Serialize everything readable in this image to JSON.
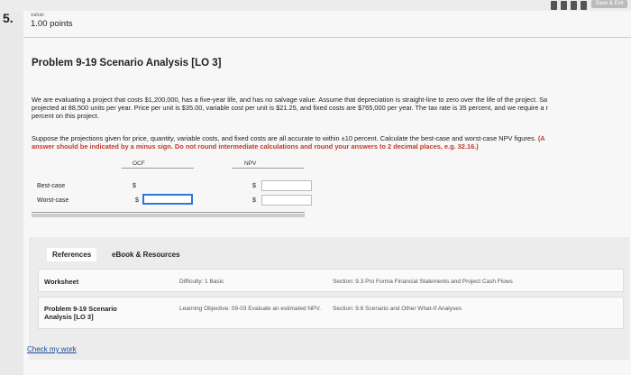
{
  "topbar": {
    "save_exit_label": "Save & Exit"
  },
  "question": {
    "number": "5.",
    "value_label": "value:",
    "points": "1.00 points",
    "title": "Problem 9-19 Scenario Analysis [LO 3]",
    "para1": [
      "We are evaluating a project that costs $1,200,000, has a five-year life, and has no salvage value. Assume that depreciation is straight-line to zero over the life of the project. Sa",
      "projected at 88,500 units per year. Price per unit is $35.00, variable cost per unit is $21.25, and fixed costs are $765,000 per year. The tax rate is 35 percent, and we require a r",
      "percent on this project."
    ],
    "para2_line1": "Suppose the projections given for price, quantity, variable costs, and fixed costs are all accurate to within ±10 percent. Calculate the best-case and worst-case NPV figures.",
    "para2_line1_red": "(A",
    "para2_line2_red": "answer should be indicated by a minus sign. Do not round intermediate calculations and round your answers to 2 decimal places, e.g. 32.16.)"
  },
  "table": {
    "col_ocf": "OCF",
    "col_npv": "NPV",
    "currency": "$",
    "rows": [
      {
        "label": "Best-case",
        "ocf": "",
        "npv": ""
      },
      {
        "label": "Worst-case",
        "ocf": "",
        "npv": ""
      }
    ]
  },
  "references": {
    "tabs": [
      "References",
      "eBook & Resources"
    ],
    "row1": {
      "name": "Worksheet",
      "difficulty": "Difficulty: 1 Basic",
      "section": "Section: 9.3 Pro Forma Financial Statements and Project Cash Flows"
    },
    "row2": {
      "name": "Problem 9-19 Scenario Analysis [LO 3]",
      "objective": "Learning Objective: 09-03 Evaluate an estimated NPV.",
      "section": "Section: 9.6 Scenario and Other What-If Analyses"
    }
  },
  "footer": {
    "check_label": "Check my work"
  }
}
